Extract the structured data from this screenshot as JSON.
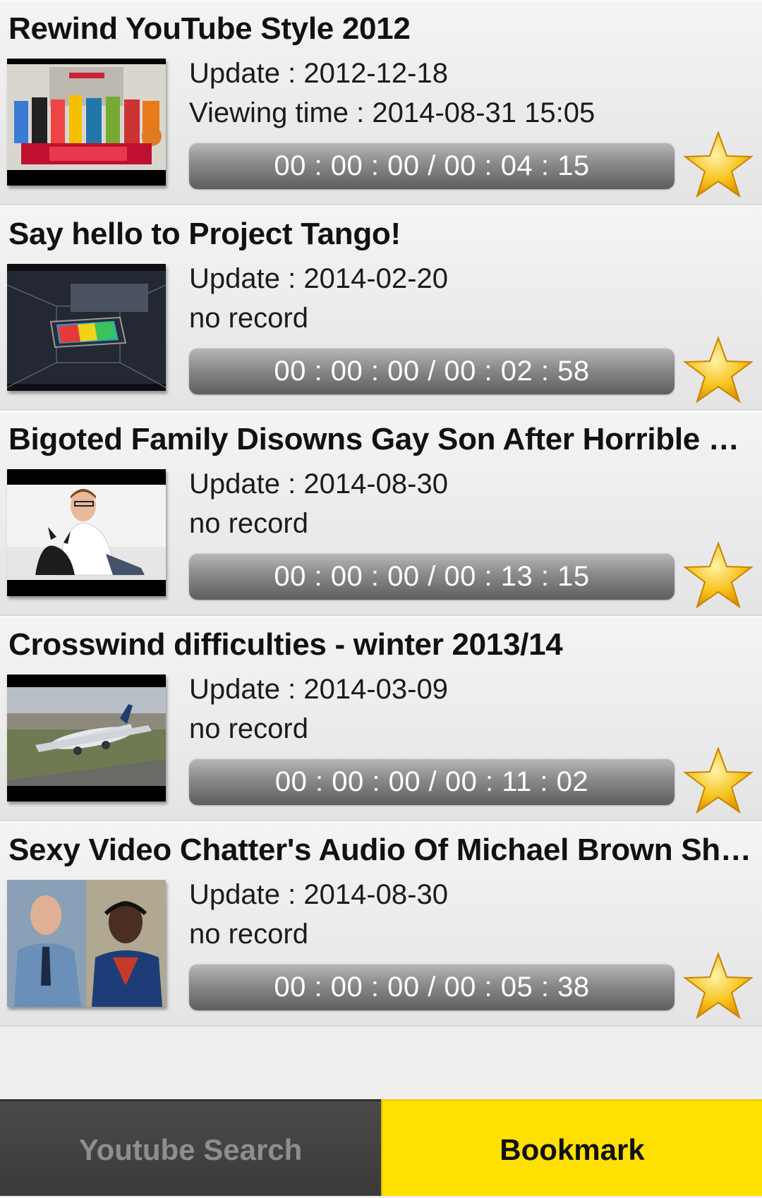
{
  "videos": [
    {
      "title": "Rewind YouTube Style 2012",
      "update": "Update : 2012-12-18",
      "status": "Viewing time : 2014-08-31 15:05",
      "progress": "00 : 00 : 00 / 00 : 04 : 15",
      "thumbnail": "rewind-youtube-style-thumbnail"
    },
    {
      "title": "Say hello to Project Tango!",
      "update": "Update : 2014-02-20",
      "status": "no record",
      "progress": "00 : 00 : 00 / 00 : 02 : 58",
      "thumbnail": "project-tango-thumbnail"
    },
    {
      "title": "Bigoted Family Disowns Gay Son After Horrible Fai...",
      "update": "Update : 2014-08-30",
      "status": "no record",
      "progress": "00 : 00 : 00 / 00 : 13 : 15",
      "thumbnail": "man-with-dog-thumbnail"
    },
    {
      "title": "Crosswind difficulties - winter 2013/14",
      "update": "Update : 2014-03-09",
      "status": "no record",
      "progress": "00 : 00 : 00 / 00 : 11 : 02",
      "thumbnail": "airplane-landing-thumbnail"
    },
    {
      "title": "Sexy Video Chatter's Audio Of Michael Brown Shoo...",
      "update": "Update : 2014-08-30",
      "status": "no record",
      "progress": "00 : 00 : 00 / 00 : 05 : 38",
      "thumbnail": "two-portraits-thumbnail"
    }
  ],
  "tabs": {
    "search": "Youtube Search",
    "bookmark": "Bookmark"
  },
  "icons": {
    "bookmark": "star-icon"
  },
  "colors": {
    "active_tab": "#ffe000",
    "inactive_tab": "#444444",
    "star": "#f7c21a"
  }
}
